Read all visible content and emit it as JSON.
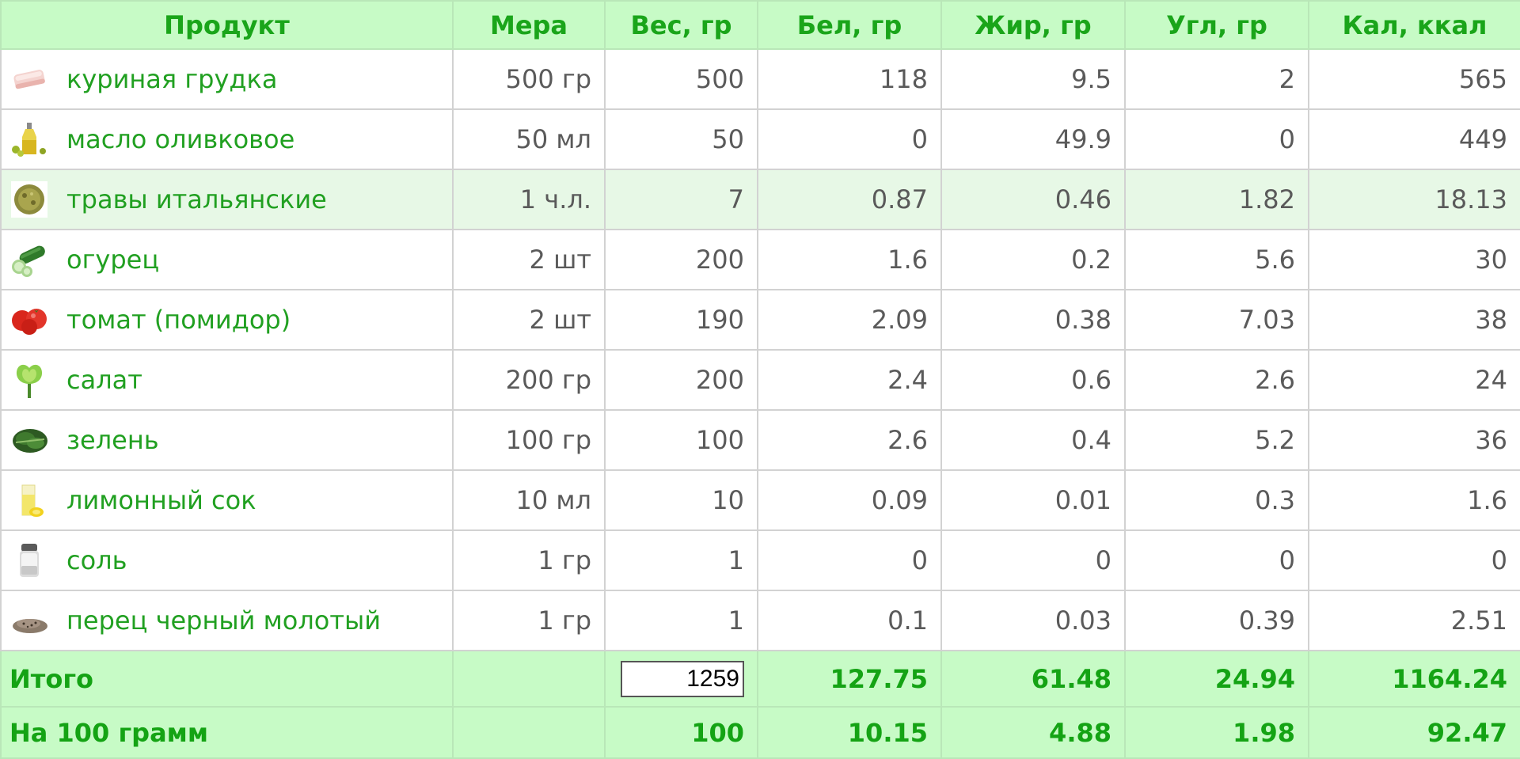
{
  "columns": [
    "Продукт",
    "Мера",
    "Вес, гр",
    "Бел, гр",
    "Жир, гр",
    "Угл, гр",
    "Кал, ккал"
  ],
  "rows": [
    {
      "icon": "chicken-breast-icon",
      "product": "куриная грудка",
      "measure": "500 гр",
      "weight": "500",
      "protein": "118",
      "fat": "9.5",
      "carbs": "2",
      "kcal": "565"
    },
    {
      "icon": "olive-oil-icon",
      "product": "масло оливковое",
      "measure": "50 мл",
      "weight": "50",
      "protein": "0",
      "fat": "49.9",
      "carbs": "0",
      "kcal": "449"
    },
    {
      "icon": "italian-herbs-icon",
      "product": "травы итальянские",
      "measure": "1 ч.л.",
      "weight": "7",
      "protein": "0.87",
      "fat": "0.46",
      "carbs": "1.82",
      "kcal": "18.13"
    },
    {
      "icon": "cucumber-icon",
      "product": "огурец",
      "measure": "2 шт",
      "weight": "200",
      "protein": "1.6",
      "fat": "0.2",
      "carbs": "5.6",
      "kcal": "30"
    },
    {
      "icon": "tomato-icon",
      "product": "томат (помидор)",
      "measure": "2 шт",
      "weight": "190",
      "protein": "2.09",
      "fat": "0.38",
      "carbs": "7.03",
      "kcal": "38"
    },
    {
      "icon": "lettuce-icon",
      "product": "салат",
      "measure": "200 гр",
      "weight": "200",
      "protein": "2.4",
      "fat": "0.6",
      "carbs": "2.6",
      "kcal": "24"
    },
    {
      "icon": "greens-icon",
      "product": "зелень",
      "measure": "100 гр",
      "weight": "100",
      "protein": "2.6",
      "fat": "0.4",
      "carbs": "5.2",
      "kcal": "36"
    },
    {
      "icon": "lemon-juice-icon",
      "product": "лимонный сок",
      "measure": "10 мл",
      "weight": "10",
      "protein": "0.09",
      "fat": "0.01",
      "carbs": "0.3",
      "kcal": "1.6"
    },
    {
      "icon": "salt-icon",
      "product": "соль",
      "measure": "1 гр",
      "weight": "1",
      "protein": "0",
      "fat": "0",
      "carbs": "0",
      "kcal": "0"
    },
    {
      "icon": "black-pepper-icon",
      "product": "перец черный молотый",
      "measure": "1 гр",
      "weight": "1",
      "protein": "0.1",
      "fat": "0.03",
      "carbs": "0.39",
      "kcal": "2.51"
    }
  ],
  "total": {
    "label": "Итого",
    "weight_value": "1259",
    "protein": "127.75",
    "fat": "61.48",
    "carbs": "24.94",
    "kcal": "1164.24"
  },
  "per100": {
    "label": "На 100 грамм",
    "weight": "100",
    "protein": "10.15",
    "fat": "4.88",
    "carbs": "1.98",
    "kcal": "92.47"
  },
  "colors": {
    "header_bg": "#c7fbc6",
    "accent_green": "#1aa51a",
    "highlight_row_bg": "#e7f8e6",
    "text_gray": "#5a5a5a"
  }
}
